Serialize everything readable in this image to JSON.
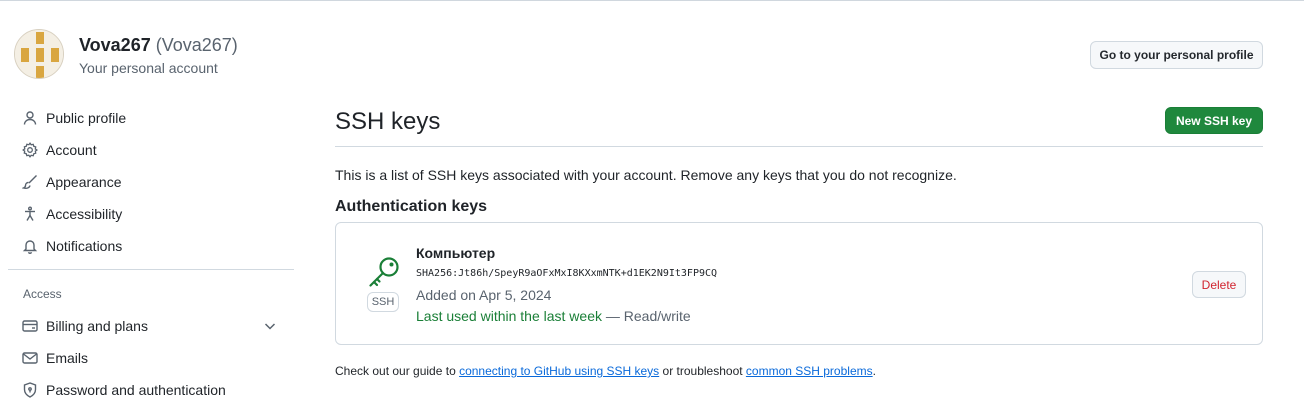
{
  "account": {
    "name": "Vova267",
    "login": "(Vova267)",
    "subtitle": "Your personal account",
    "profile_button": "Go to your personal profile"
  },
  "sidebar": {
    "items": [
      {
        "label": "Public profile",
        "icon": "person-icon"
      },
      {
        "label": "Account",
        "icon": "gear-icon"
      },
      {
        "label": "Appearance",
        "icon": "paintbrush-icon"
      },
      {
        "label": "Accessibility",
        "icon": "accessibility-icon"
      },
      {
        "label": "Notifications",
        "icon": "bell-icon"
      }
    ],
    "access_heading": "Access",
    "access_items": [
      {
        "label": "Billing and plans",
        "icon": "credit-card-icon",
        "expandable": true
      },
      {
        "label": "Emails",
        "icon": "mail-icon"
      },
      {
        "label": "Password and authentication",
        "icon": "shield-lock-icon"
      }
    ]
  },
  "main": {
    "title": "SSH keys",
    "new_key_button": "New SSH key",
    "intro": "This is a list of SSH keys associated with your account. Remove any keys that you do not recognize.",
    "section_heading": "Authentication keys",
    "keys": [
      {
        "title": "Компьютер",
        "fingerprint": "SHA256:Jt86h/SpeyR9aOFxMxI8KXxmNTK+d1EK2N9It3FP9CQ",
        "added": "Added on Apr 5, 2024",
        "last_used": "Last used within the last week",
        "access": "— Read/write",
        "badge": "SSH",
        "delete_label": "Delete"
      }
    ],
    "footer": {
      "text_before": "Check out our guide to ",
      "link1": "connecting to GitHub using SSH keys",
      "text_middle": " or troubleshoot ",
      "link2": "common SSH problems",
      "text_after": "."
    }
  },
  "colors": {
    "primary_button": "#1f883d",
    "danger": "#d1242f",
    "link": "#0969da",
    "success_text": "#1a7f37"
  }
}
